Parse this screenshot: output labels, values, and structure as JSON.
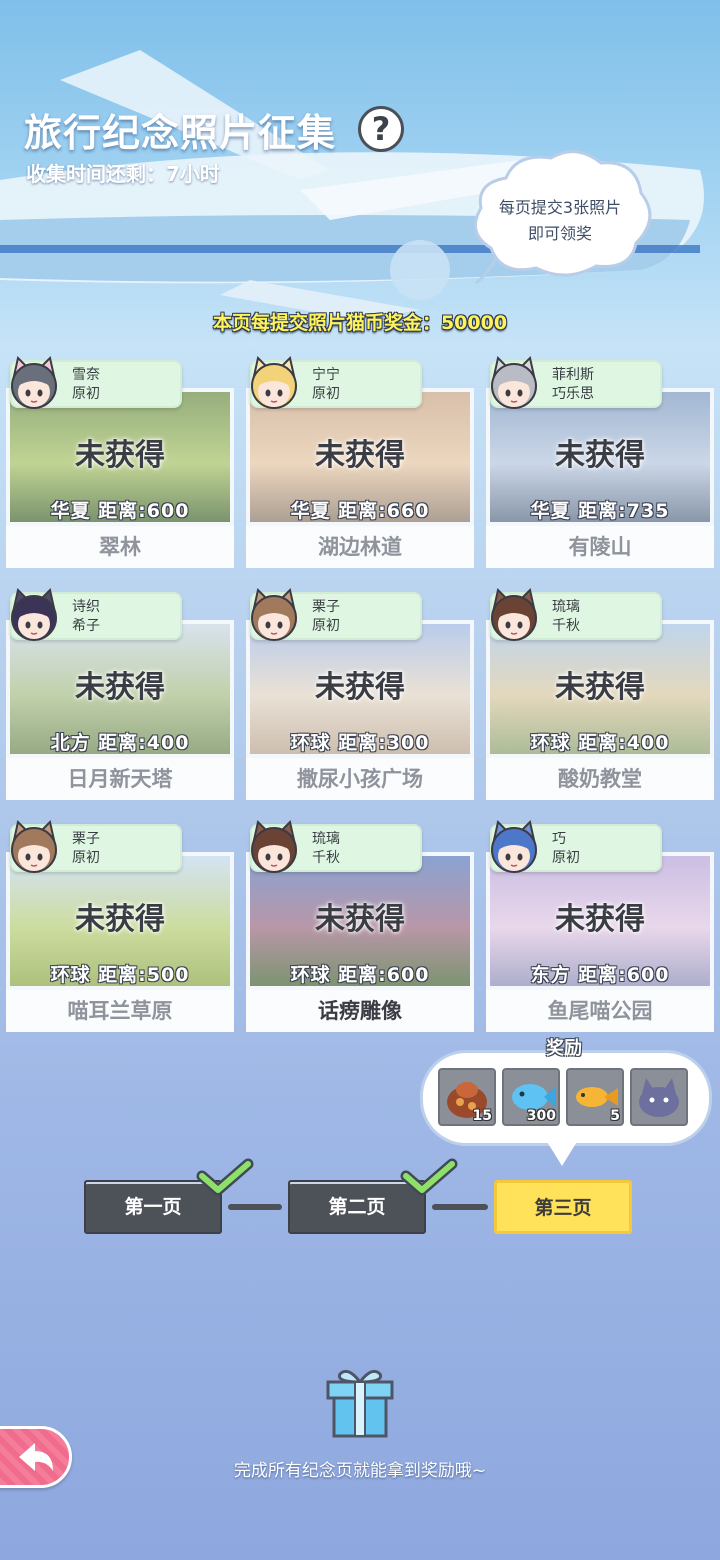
{
  "header": {
    "title": "旅行纪念照片征集",
    "help": "?",
    "timer": "收集时间还剩：7小时"
  },
  "tip": {
    "line1": "每页提交3张照片",
    "line2": "即可领奖"
  },
  "bonus": "本页每提交照片猫币奖金：50000",
  "unobtained": "未获得",
  "cards": [
    {
      "who1": "雪奈",
      "who2": "原初",
      "dist": "华夏  距离:600",
      "name": "翠林",
      "hair": "#6a6f7c",
      "ear": "#f4c8d8",
      "photo": [
        "#6f8f4c",
        "#a8c36a",
        "#486a36"
      ]
    },
    {
      "who1": "宁宁",
      "who2": "原初",
      "dist": "华夏  距离:660",
      "name": "湖边林道",
      "hair": "#f2d37a",
      "ear": "#f7e7b3",
      "photo": [
        "#c9a88a",
        "#e6c7a5",
        "#8c7b6a"
      ]
    },
    {
      "who1": "菲利斯",
      "who2": "巧乐思",
      "dist": "华夏  距离:735",
      "name": "有陵山",
      "hair": "#b9bcc4",
      "ear": "#d7d9de",
      "photo": [
        "#7f9cc2",
        "#b7c8de",
        "#5d6f8a"
      ]
    },
    {
      "who1": "诗织",
      "who2": "希子",
      "dist": "北方  距离:400",
      "name": "日月新天塔",
      "hair": "#3b3457",
      "ear": "#524a6e",
      "photo": [
        "#c9d8e6",
        "#a9bf8a",
        "#6f8a54"
      ]
    },
    {
      "who1": "栗子",
      "who2": "原初",
      "dist": "环球  距离:300",
      "name": "撒尿小孩广场",
      "hair": "#a17a5d",
      "ear": "#c49b7c",
      "photo": [
        "#9fb9e3",
        "#e2d6c6",
        "#b9a68f"
      ]
    },
    {
      "who1": "琉璃",
      "who2": "千秋",
      "dist": "环球  距离:400",
      "name": "酸奶教堂",
      "hair": "#6b4335",
      "ear": "#8a5a48",
      "photo": [
        "#a7c6e6",
        "#d9c9a3",
        "#8da270"
      ]
    },
    {
      "who1": "栗子",
      "who2": "原初",
      "dist": "环球  距离:500",
      "name": "喵耳兰草原",
      "hair": "#a17a5d",
      "ear": "#c49b7c",
      "photo": [
        "#c4d9ef",
        "#b9cf7a",
        "#8ea94c"
      ]
    },
    {
      "who1": "琉璃",
      "who2": "千秋",
      "dist": "环球  距离:600",
      "name": "话痨雕像",
      "hair": "#6b4335",
      "ear": "#8a5a48",
      "photo": [
        "#5f7fc0",
        "#9d6f86",
        "#4b6a3a"
      ]
    },
    {
      "who1": "巧",
      "who2": "原初",
      "dist": "东方  距离:600",
      "name": "鱼尾喵公园",
      "hair": "#4d78c9",
      "ear": "#6f94d8",
      "photo": [
        "#b7a6d9",
        "#e0c8e3",
        "#8e8fb8"
      ]
    }
  ],
  "reward": {
    "title": "奖励",
    "items": [
      {
        "icon": "gift-bag-icon",
        "count": "15"
      },
      {
        "icon": "blue-fish-icon",
        "count": "300"
      },
      {
        "icon": "golden-fish-icon",
        "count": "5"
      },
      {
        "icon": "cat-plush-icon",
        "count": ""
      }
    ]
  },
  "pages": [
    {
      "label": "第一页",
      "done": true
    },
    {
      "label": "第二页",
      "done": true
    },
    {
      "label": "第三页",
      "done": false
    }
  ],
  "footer": "完成所有纪念页就能拿到奖励哦~",
  "colors": {
    "accent": "#ffe25a",
    "bonus": "#fff35a",
    "tag": "#dff7e2",
    "back": "#f06b8c"
  }
}
